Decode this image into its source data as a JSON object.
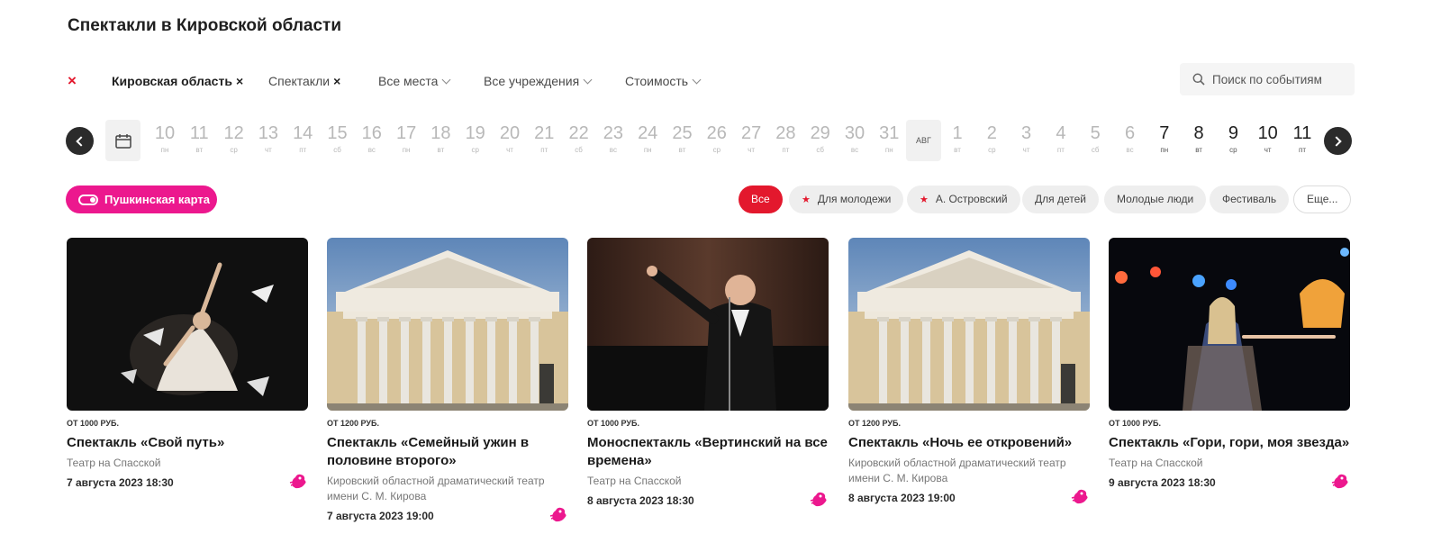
{
  "page": {
    "title": "Спектакли в Кировской области"
  },
  "filters": {
    "clear_symbol": "×",
    "items": [
      {
        "label": "Кировская область",
        "active": true,
        "remove": "×"
      },
      {
        "label": "Спектакли",
        "active": true,
        "remove": "×"
      },
      {
        "label": "Все места",
        "active": false
      },
      {
        "label": "Все учреждения",
        "active": false
      },
      {
        "label": "Стоимость",
        "active": false
      }
    ],
    "search_placeholder": "Поиск по событиям"
  },
  "dates": {
    "days": [
      {
        "num": "10",
        "wd": "пн"
      },
      {
        "num": "11",
        "wd": "вт"
      },
      {
        "num": "12",
        "wd": "ср"
      },
      {
        "num": "13",
        "wd": "чт"
      },
      {
        "num": "14",
        "wd": "пт"
      },
      {
        "num": "15",
        "wd": "сб"
      },
      {
        "num": "16",
        "wd": "вс"
      },
      {
        "num": "17",
        "wd": "пн"
      },
      {
        "num": "18",
        "wd": "вт"
      },
      {
        "num": "19",
        "wd": "ср"
      },
      {
        "num": "20",
        "wd": "чт"
      },
      {
        "num": "21",
        "wd": "пт"
      },
      {
        "num": "22",
        "wd": "сб"
      },
      {
        "num": "23",
        "wd": "вс"
      },
      {
        "num": "24",
        "wd": "пн"
      },
      {
        "num": "25",
        "wd": "вт"
      },
      {
        "num": "26",
        "wd": "ср"
      },
      {
        "num": "27",
        "wd": "чт"
      },
      {
        "num": "28",
        "wd": "пт"
      },
      {
        "num": "29",
        "wd": "сб"
      },
      {
        "num": "30",
        "wd": "вс"
      },
      {
        "num": "31",
        "wd": "пн"
      }
    ],
    "month_label": "АВГ",
    "days_after": [
      {
        "num": "1",
        "wd": "вт",
        "active": false
      },
      {
        "num": "2",
        "wd": "ср",
        "active": false
      },
      {
        "num": "3",
        "wd": "чт",
        "active": false
      },
      {
        "num": "4",
        "wd": "пт",
        "active": false
      },
      {
        "num": "5",
        "wd": "сб",
        "active": false
      },
      {
        "num": "6",
        "wd": "вс",
        "active": false
      },
      {
        "num": "7",
        "wd": "пн",
        "active": true
      },
      {
        "num": "8",
        "wd": "вт",
        "active": true
      },
      {
        "num": "9",
        "wd": "ср",
        "active": true
      },
      {
        "num": "10",
        "wd": "чт",
        "active": true
      },
      {
        "num": "11",
        "wd": "пт",
        "active": true
      }
    ]
  },
  "pushkin": {
    "label": "Пушкинская карта"
  },
  "tags": [
    {
      "label": "Все",
      "style": "all"
    },
    {
      "label": "Для молодежи",
      "star": true
    },
    {
      "label": "А. Островский",
      "star": true
    },
    {
      "label": "Для детей"
    },
    {
      "label": "Молодые люди"
    },
    {
      "label": "Фестиваль"
    },
    {
      "label": "Еще...",
      "style": "outline"
    }
  ],
  "star_symbol": "★",
  "cards": [
    {
      "price": "ОТ 1000 РУБ.",
      "title": "Спектакль «Свой путь»",
      "venue": "Театр на Спасской",
      "datetime": "7 августа 2023 18:30",
      "image": "dancer"
    },
    {
      "price": "ОТ 1200 РУБ.",
      "title": "Спектакль «Семейный ужин в половине второго»",
      "venue": "Кировский областной драматический театр имени С. М. Кирова",
      "datetime": "7 августа 2023 19:00",
      "image": "theatre"
    },
    {
      "price": "ОТ 1000 РУБ.",
      "title": "Моноспектакль «Вертинский на все времена»",
      "venue": "Театр на Спасской",
      "datetime": "8 августа 2023 18:30",
      "image": "singer"
    },
    {
      "price": "ОТ 1200 РУБ.",
      "title": "Спектакль «Ночь ее откровений»",
      "venue": "Кировский областной драматический театр имени С. М. Кирова",
      "datetime": "8 августа 2023 19:00",
      "image": "theatre"
    },
    {
      "price": "ОТ 1000 РУБ.",
      "title": "Спектакль «Гори, гори, моя звезда»",
      "venue": "Театр на Спасской",
      "datetime": "9 августа 2023 18:30",
      "image": "singer-woman"
    }
  ],
  "colors": {
    "accent_red": "#e3182d",
    "pushkin_pink": "#ec188e"
  }
}
